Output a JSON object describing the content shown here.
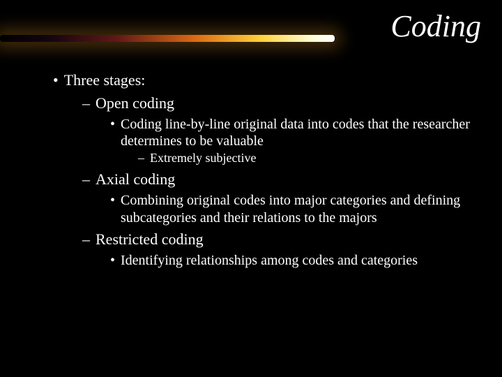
{
  "title": "Coding",
  "l1": "Three stages:",
  "stage1": {
    "name": "Open coding",
    "detail": "Coding line-by-line original data into codes that the researcher determines to be valuable",
    "sub": "Extremely subjective"
  },
  "stage2": {
    "name": "Axial coding",
    "detail": "Combining original codes into major categories and defining subcategories and their relations to the majors"
  },
  "stage3": {
    "name": "Restricted coding",
    "detail": "Identifying relationships among codes and categories"
  }
}
